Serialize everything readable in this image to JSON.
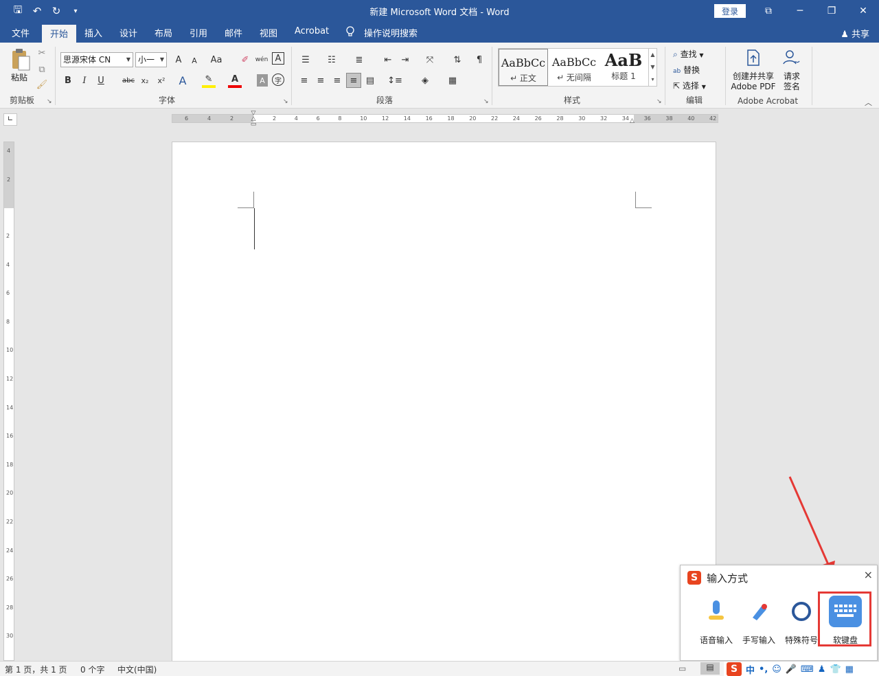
{
  "titlebar": {
    "title": "新建 Microsoft Word 文档  -  Word",
    "login": "登录",
    "qat": {
      "save": "🖫",
      "undo": "↶",
      "redo": "↻",
      "customize": "▾"
    },
    "win": {
      "ribbon_opts": "⧉",
      "min": "─",
      "max": "❐",
      "close": "✕"
    }
  },
  "tabs": {
    "items": [
      "文件",
      "开始",
      "插入",
      "设计",
      "布局",
      "引用",
      "邮件",
      "视图",
      "Acrobat",
      "操作说明搜索"
    ],
    "active": "开始",
    "share": "共享"
  },
  "ribbon": {
    "clipboard": {
      "paste": "粘贴",
      "label": "剪贴板"
    },
    "font": {
      "family": "思源宋体 CN",
      "size": "小一",
      "label": "字体",
      "bold": "B",
      "italic": "I",
      "underline": "U",
      "strike": "abc",
      "sub": "x₂",
      "sup": "x²",
      "grow": "A",
      "shrink": "A",
      "case": "Aa",
      "phonetic": "wén",
      "border": "A",
      "effects": "A",
      "color": "A",
      "shade": "A",
      "enclose": "字"
    },
    "paragraph": {
      "label": "段落"
    },
    "styles": {
      "label": "样式",
      "items": [
        {
          "sample": "AaBbCc",
          "name": "↵ 正文"
        },
        {
          "sample": "AaBbCc",
          "name": "↵ 无间隔"
        },
        {
          "sample": "AaB",
          "name": "标题 1"
        }
      ]
    },
    "editing": {
      "find": "查找",
      "replace": "替换",
      "select": "选择",
      "label": "编辑"
    },
    "acrobat": {
      "create": "创建并共享",
      "create2": "Adobe PDF",
      "sign": "请求",
      "sign2": "签名",
      "label": "Adobe Acrobat"
    }
  },
  "ruler": {
    "h_left": [
      "6",
      "4",
      "2"
    ],
    "h_right": [
      "2",
      "4",
      "6",
      "8",
      "10",
      "12",
      "14",
      "16",
      "18",
      "20",
      "22",
      "24",
      "26",
      "28",
      "30",
      "32",
      "34",
      "36",
      "38",
      "40",
      "42"
    ],
    "v_top": [
      "4",
      "2"
    ],
    "v_down": [
      "2",
      "4",
      "6",
      "8",
      "10",
      "12",
      "14",
      "16",
      "18",
      "20",
      "22",
      "24",
      "26",
      "28",
      "30"
    ]
  },
  "ime_panel": {
    "title": "输入方式",
    "close": "×",
    "items": [
      {
        "label": "语音输入",
        "icon": "microphone-icon"
      },
      {
        "label": "手写输入",
        "icon": "pen-icon"
      },
      {
        "label": "特殊符号",
        "icon": "omega-icon"
      },
      {
        "label": "软键盘",
        "icon": "keyboard-icon"
      }
    ]
  },
  "statusbar": {
    "page": "第 1 页，共 1 页",
    "words": "0 个字",
    "lang": "中文(中国)",
    "ime": {
      "cn": "中",
      "punct": "•,",
      "emoji": "☺",
      "mic": "🎤",
      "kb": "⌨",
      "skin": "👕",
      "tools": "▦",
      "user": "♟"
    }
  }
}
